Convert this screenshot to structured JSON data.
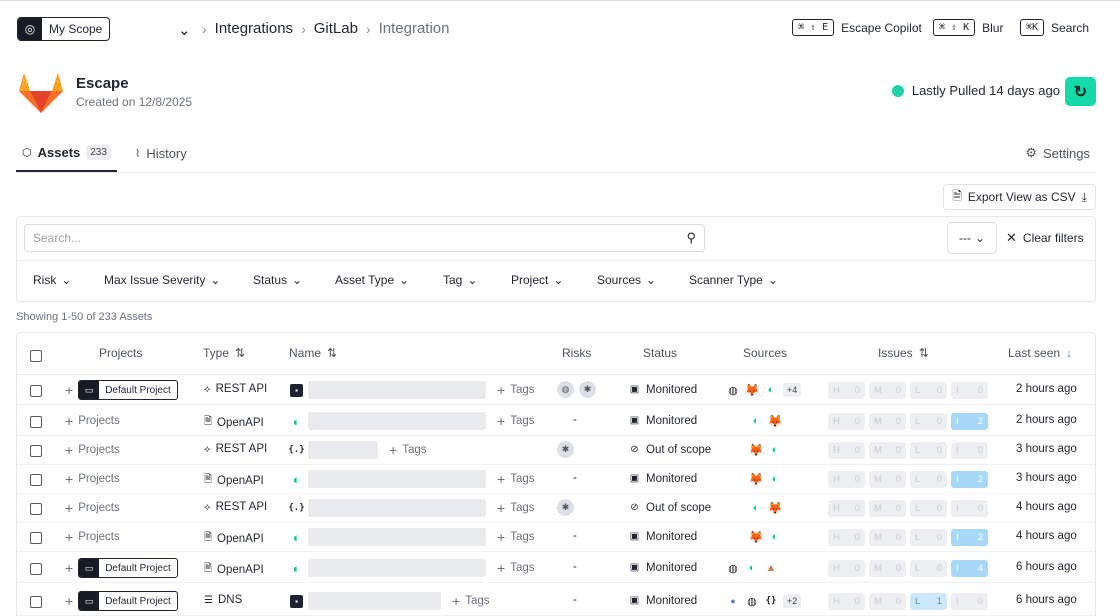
{
  "topbar": {
    "scope_label": "My Scope",
    "breadcrumbs": [
      "Integrations",
      "GitLab",
      "Integration"
    ],
    "shortcuts": [
      {
        "keys": "⌘ ⇧ E",
        "label": "Escape Copilot"
      },
      {
        "keys": "⌘ ⇧ K",
        "label": "Blur"
      },
      {
        "keys": "⌘K",
        "label": "Search"
      }
    ]
  },
  "header": {
    "title": "Escape",
    "subtitle": "Created on 12/8/2025",
    "pulled_status": "Lastly Pulled 14 days ago",
    "status_color": "#1fd3a6",
    "accent_color": "#15d9a8"
  },
  "tabs": {
    "assets_label": "Assets",
    "assets_count": "233",
    "history_label": "History",
    "settings_label": "Settings"
  },
  "toolbar": {
    "export_label": "Export View as CSV",
    "search_placeholder": "Search...",
    "dash_select": "---",
    "clear_filters": "Clear filters",
    "filters": [
      "Risk",
      "Max Issue Severity",
      "Status",
      "Asset Type",
      "Tag",
      "Project",
      "Sources",
      "Scanner Type"
    ],
    "showing": "Showing 1-50 of 233 Assets"
  },
  "table": {
    "columns": [
      "Projects",
      "Type",
      "Name",
      "Risks",
      "Status",
      "Sources",
      "Issues",
      "Last seen"
    ],
    "rows": [
      {
        "project": "Default Project",
        "type": "REST API",
        "type_icon": "rest-api-icon",
        "name_icon": "dark-favicon",
        "tags": "Tags",
        "risks": [
          "globe-risk-icon",
          "bug-risk-icon"
        ],
        "status": "Monitored",
        "sources": [
          "globe-icon",
          "gitlab-icon",
          "escape-icon"
        ],
        "sources_more": "+4",
        "issues": {
          "H": "0",
          "M": "0",
          "L": "0",
          "I": "0"
        },
        "last_seen": "2 hours ago"
      },
      {
        "project": "Projects",
        "type": "OpenAPI",
        "type_icon": "openapi-icon",
        "name_icon": "escape-favicon",
        "tags": "Tags",
        "risks": "-",
        "status": "Monitored",
        "sources": [
          "escape-icon",
          "gitlab-icon"
        ],
        "sources_more": "",
        "issues": {
          "H": "0",
          "M": "0",
          "L": "0",
          "I": "2"
        },
        "last_seen": "2 hours ago"
      },
      {
        "project": "Projects",
        "type": "REST API",
        "type_icon": "rest-api-icon",
        "name_icon": "braces-favicon",
        "tags": "Tags",
        "risks": [
          "bug-risk-icon"
        ],
        "status": "Out of scope",
        "sources": [
          "gitlab-icon",
          "escape-icon"
        ],
        "sources_more": "",
        "issues": {
          "H": "0",
          "M": "0",
          "L": "0",
          "I": "0"
        },
        "last_seen": "3 hours ago"
      },
      {
        "project": "Projects",
        "type": "OpenAPI",
        "type_icon": "openapi-icon",
        "name_icon": "escape-favicon",
        "tags": "Tags",
        "risks": "-",
        "status": "Monitored",
        "sources": [
          "gitlab-icon",
          "escape-icon"
        ],
        "sources_more": "",
        "issues": {
          "H": "0",
          "M": "0",
          "L": "0",
          "I": "2"
        },
        "last_seen": "3 hours ago"
      },
      {
        "project": "Projects",
        "type": "REST API",
        "type_icon": "rest-api-icon",
        "name_icon": "braces-favicon",
        "tags": "Tags",
        "risks": [
          "bug-risk-icon"
        ],
        "status": "Out of scope",
        "sources": [
          "escape-icon",
          "gitlab-icon"
        ],
        "sources_more": "",
        "issues": {
          "H": "0",
          "M": "0",
          "L": "0",
          "I": "0"
        },
        "last_seen": "4 hours ago"
      },
      {
        "project": "Projects",
        "type": "OpenAPI",
        "type_icon": "openapi-icon",
        "name_icon": "escape-favicon",
        "tags": "Tags",
        "risks": "-",
        "status": "Monitored",
        "sources": [
          "gitlab-icon",
          "escape-icon"
        ],
        "sources_more": "",
        "issues": {
          "H": "0",
          "M": "0",
          "L": "0",
          "I": "2"
        },
        "last_seen": "4 hours ago"
      },
      {
        "project": "Default Project",
        "type": "OpenAPI",
        "type_icon": "openapi-icon",
        "name_icon": "escape-favicon",
        "tags": "Tags",
        "risks": "-",
        "status": "Monitored",
        "sources": [
          "globe-icon",
          "escape-icon",
          "photo-icon"
        ],
        "sources_more": "",
        "issues": {
          "H": "0",
          "M": "0",
          "L": "0",
          "I": "4"
        },
        "last_seen": "6 hours ago"
      },
      {
        "project": "Default Project",
        "type": "DNS",
        "type_icon": "dns-icon",
        "name_icon": "dark-favicon",
        "tags": "Tags",
        "risks": "-",
        "status": "Monitored",
        "sources": [
          "dot-icon",
          "globe-icon",
          "braces-icon"
        ],
        "sources_more": "+2",
        "issues": {
          "H": "0",
          "M": "0",
          "L": "1",
          "I": "0"
        },
        "last_seen": "6 hours ago"
      }
    ]
  }
}
